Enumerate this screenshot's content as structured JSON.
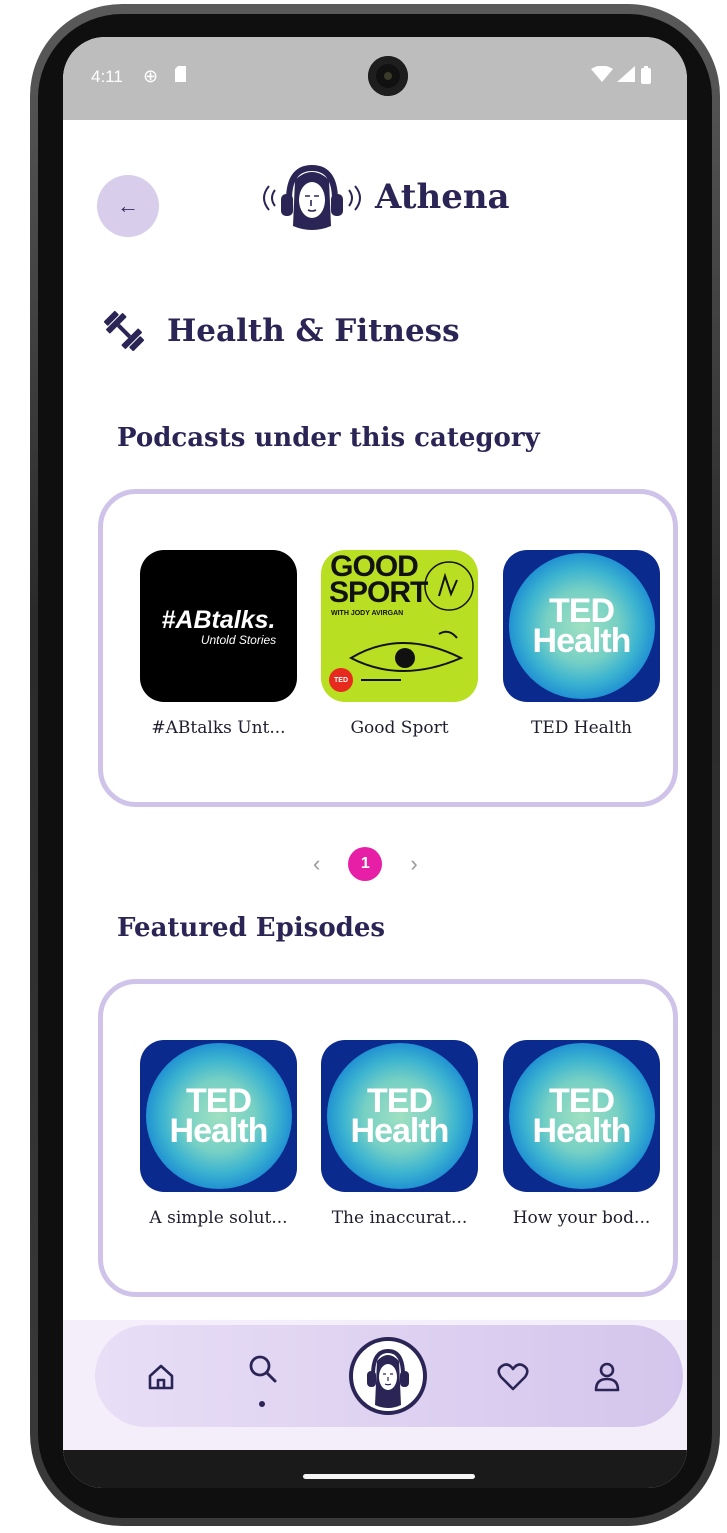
{
  "status_bar": {
    "time": "4:11"
  },
  "header": {
    "back_icon": "arrow-left-icon",
    "app_name": "Athena"
  },
  "category": {
    "icon": "dumbbell-icon",
    "title": "Health & Fitness"
  },
  "podcasts_section": {
    "title": "Podcasts under this category",
    "items": [
      {
        "label": "#ABtalks Unt...",
        "art_title": "#ABtalks.",
        "art_subtitle": "Untold Stories"
      },
      {
        "label": "Good Sport",
        "art_title": "GOOD SPORT",
        "art_subtitle": "WITH JODY AVIRGAN",
        "art_badge": "TED"
      },
      {
        "label": "TED Health",
        "art_title_1": "TED",
        "art_title_2": "Health"
      }
    ]
  },
  "pagination": {
    "prev": "‹",
    "current": "1",
    "next": "›"
  },
  "episodes_section": {
    "title": "Featured Episodes",
    "items": [
      {
        "label": "A simple solut...",
        "art_title_1": "TED",
        "art_title_2": "Health"
      },
      {
        "label": "The inaccurat...",
        "art_title_1": "TED",
        "art_title_2": "Health"
      },
      {
        "label": "How your bod...",
        "art_title_1": "TED",
        "art_title_2": "Health"
      }
    ]
  },
  "bottom_nav": {
    "items": [
      "home-icon",
      "search-icon",
      "athena-logo",
      "heart-icon",
      "profile-icon"
    ],
    "active": "search-icon"
  },
  "colors": {
    "primary_text": "#2b2556",
    "card_border": "#cfc3ea",
    "accent_pink": "#e61fa6",
    "nav_bg": "#ddd0f0"
  }
}
